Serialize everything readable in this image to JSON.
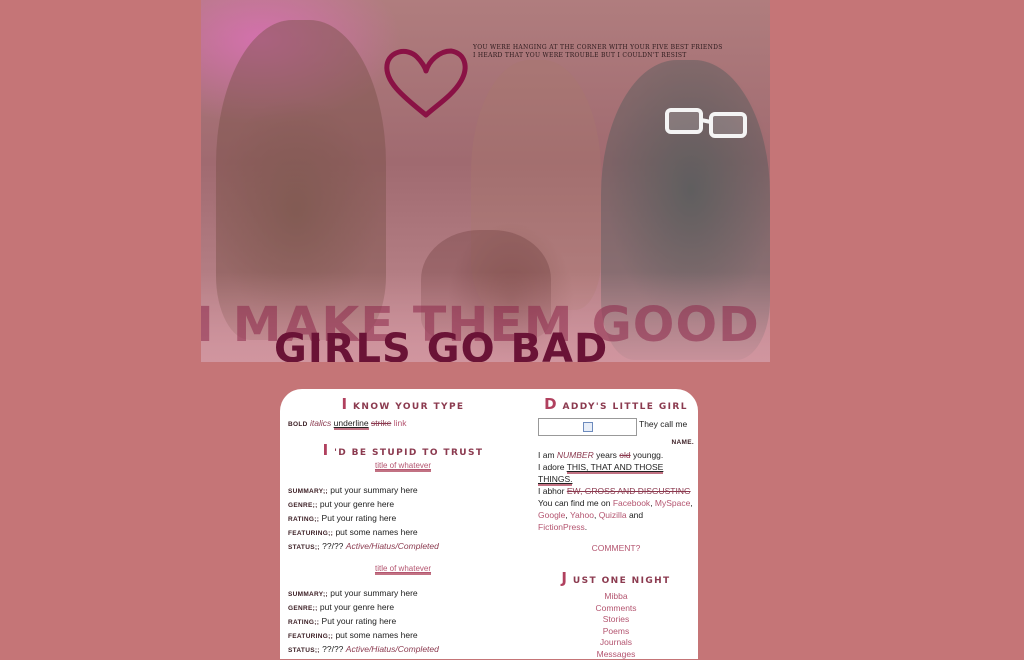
{
  "banner": {
    "quote_line1": "YOU WERE HANGING AT THE CORNER WITH YOUR FIVE BEST FRIENDS",
    "quote_line2": "I HEARD THAT YOU WERE TROUBLE BUT I COULDN'T RESIST",
    "tagline_1": "I MAKE THEM GOOD",
    "tagline_2": "GIRLS GO BAD"
  },
  "left": {
    "section1": {
      "cap": "I",
      "rest": "KNOW YOUR TYPE"
    },
    "format": {
      "bold": "BOLD",
      "italics": "italics",
      "underline": "underline",
      "strike": "strike",
      "link": "link"
    },
    "section2": {
      "cap": "I",
      "rest": "'D BE STUPID TO TRUST"
    },
    "fics": [
      {
        "title": "title of whatever",
        "summary_label": "SUMMARY;;",
        "summary": "put your summary here",
        "genre_label": "GENRE;;",
        "genre": "put your genre here",
        "rating_label": "RATING;;",
        "rating": "Put your rating here",
        "featuring_label": "FEATURING;;",
        "featuring": "put some names here",
        "status_label": "STATUS;;",
        "status_count": "??/??",
        "status": "Active/Hiatus/Completed"
      },
      {
        "title": "title of whatever",
        "summary_label": "SUMMARY;;",
        "summary": "put your summary here",
        "genre_label": "GENRE;;",
        "genre": "put your genre here",
        "rating_label": "RATING;;",
        "rating": "Put your rating here",
        "featuring_label": "FEATURING;;",
        "featuring": "put some names here",
        "status_label": "STATUS;;",
        "status_count": "??/??",
        "status": "Active/Hiatus/Completed"
      }
    ]
  },
  "right": {
    "section1": {
      "cap": "D",
      "rest": "ADDY'S LITTLE GIRL"
    },
    "they_call_me": "They call me",
    "name": "NAME.",
    "i_am": "I am",
    "number": "NUMBER",
    "years": "years",
    "old": "old",
    "youngg": "youngg.",
    "i_adore": "I adore",
    "adore_things": "THIS, THAT AND THOSE THINGS.",
    "i_abhor": "I abhor",
    "abhor_things": "EW, GROSS AND DISGUSTING",
    "find_me": "You can find me on",
    "sites": [
      "Facebook",
      "MySpace",
      "Google",
      "Yahoo",
      "Quizilla"
    ],
    "and": "and",
    "last_site": "FictionPress",
    "comment": "COMMENT?",
    "section2": {
      "cap": "J",
      "rest": "UST ONE NIGHT"
    },
    "nav": [
      "Mibba",
      "Comments",
      "Stories",
      "Poems",
      "Journals",
      "Messages"
    ]
  },
  "colors": {
    "background": "#c57577",
    "accent": "#b45570",
    "panel": "#ffffff"
  }
}
